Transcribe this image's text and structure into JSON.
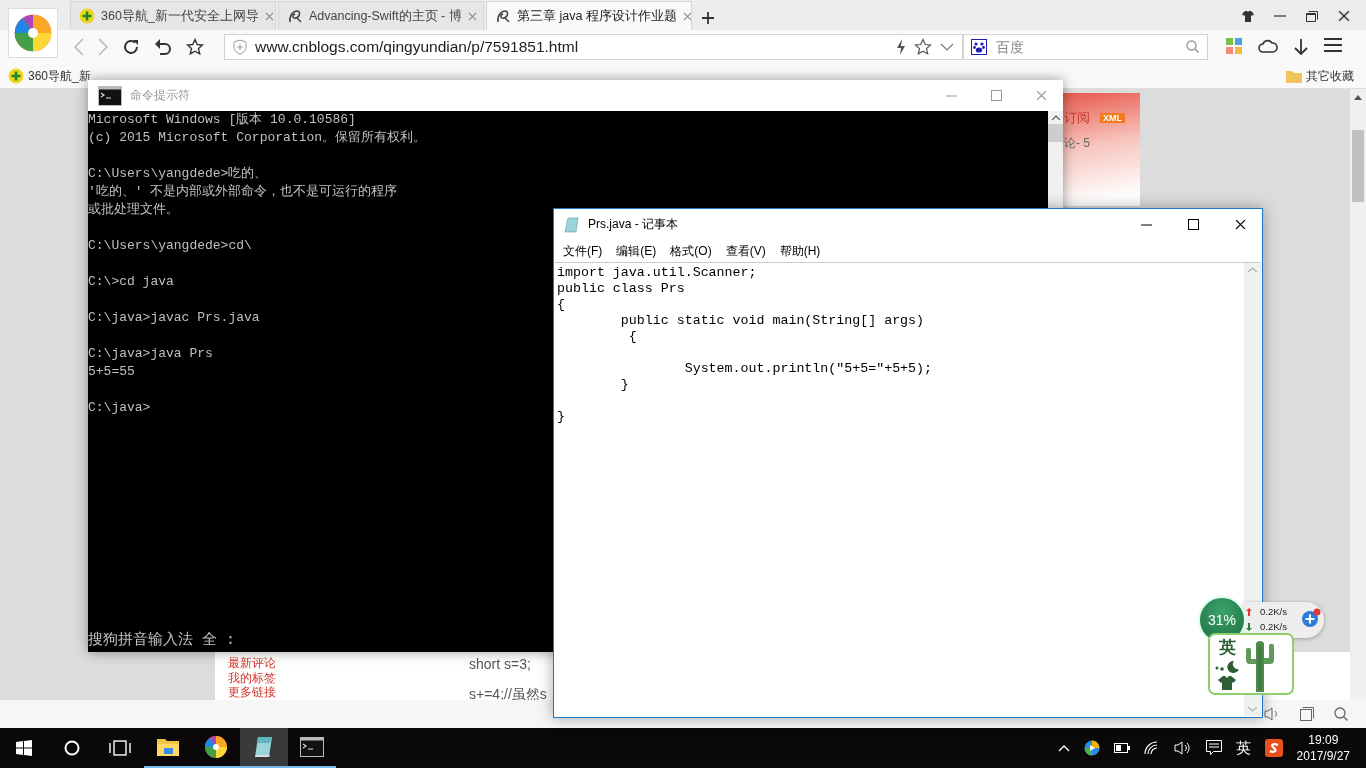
{
  "browser": {
    "tabs": [
      {
        "kind": "nav360",
        "title": "360导航_新一代安全上网导",
        "selected": false
      },
      {
        "kind": "blog",
        "title": "Advancing-Swift的主页 - 博",
        "selected": false
      },
      {
        "kind": "blog",
        "title": "第三章 java 程序设计作业题",
        "selected": true
      }
    ],
    "address": "www.cnblogs.com/qingyundian/p/7591851.html",
    "search": {
      "placeholder": "百度"
    },
    "bookmarks": [
      {
        "kind": "nav360",
        "label": "360导航_新"
      }
    ],
    "other_bookmarks": "其它收藏",
    "page": {
      "subscribe": "订阅",
      "xml_badge": "XML",
      "comment_count": "论- 5",
      "sidebar_links": [
        "最新评论",
        "我的标签",
        "更多链接"
      ],
      "code_lines": [
        "short s=3;",
        "s+=4;//虽然s"
      ]
    }
  },
  "cmd": {
    "title": "命令提示符",
    "blocks": [
      [
        "Microsoft Windows [版本 10.0.10586]",
        "(c) 2015 Microsoft Corporation。保留所有权利。"
      ],
      [
        "C:\\Users\\yangdede>吃的、",
        "'吃的、' 不是内部或外部命令，也不是可运行的程序",
        "或批处理文件。"
      ],
      [
        "C:\\Users\\yangdede>cd\\"
      ],
      [
        "C:\\>cd java"
      ],
      [
        "C:\\java>javac Prs.java"
      ],
      [
        "C:\\java>java Prs",
        "5+5=55"
      ],
      [
        "C:\\java>"
      ]
    ],
    "ime_status": "搜狗拼音输入法 全 :"
  },
  "notepad": {
    "title": "Prs.java - 记事本",
    "menu": [
      "文件(F)",
      "编辑(E)",
      "格式(O)",
      "查看(V)",
      "帮助(H)"
    ],
    "blocks": [
      [
        "import java.util.Scanner;",
        "public class Prs",
        "{",
        "\tpublic static void main(String[] args)",
        "\t {"
      ],
      [
        "\t\tSystem.out.println(\"5+5=\"+5+5);",
        "\t}"
      ],
      [
        "}"
      ]
    ]
  },
  "net_widget": {
    "usage": "31%",
    "upload": "0.2K/s",
    "download": "0.2K/s",
    "ime": "英"
  },
  "taskbar": {
    "apps": [
      {
        "kind": "explorer",
        "running": true,
        "selected": false
      },
      {
        "kind": "browser",
        "running": true,
        "selected": false
      },
      {
        "kind": "notepad",
        "running": true,
        "selected": true
      },
      {
        "kind": "console",
        "running": true,
        "selected": false
      }
    ],
    "ime": "英",
    "time": "19:09",
    "date": "2017/9/27"
  }
}
